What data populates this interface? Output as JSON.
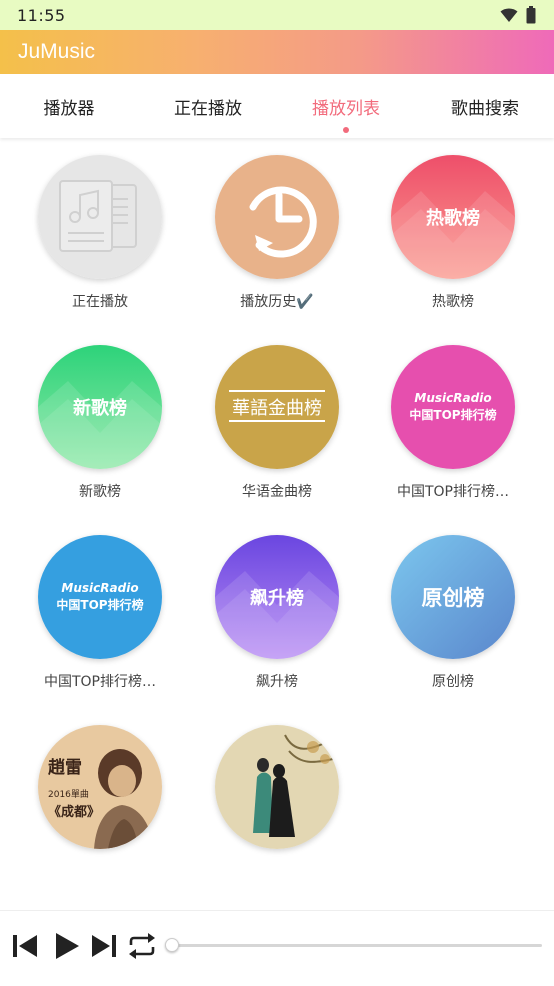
{
  "status_bar": {
    "time": "11:55"
  },
  "app": {
    "title": "JuMusic"
  },
  "tabs": [
    {
      "label": "播放器",
      "active": false
    },
    {
      "label": "正在播放",
      "active": false
    },
    {
      "label": "播放列表",
      "active": true
    },
    {
      "label": "歌曲搜索",
      "active": false
    }
  ],
  "playlists": [
    {
      "caption": "正在播放",
      "icon": "now-playing-document-icon"
    },
    {
      "caption": "播放历史✔️",
      "icon": "history-clock-icon"
    },
    {
      "caption": "热歌榜",
      "badge": "热歌榜"
    },
    {
      "caption": "新歌榜",
      "badge": "新歌榜"
    },
    {
      "caption": "华语金曲榜",
      "badge": "華語金曲榜"
    },
    {
      "caption": "中国TOP排行榜…",
      "badge_top": "MusicRadio",
      "badge_bottom": "中国TOP排行榜"
    },
    {
      "caption": "中国TOP排行榜…",
      "badge_top": "MusicRadio",
      "badge_bottom": "中国TOP排行榜"
    },
    {
      "caption": "飙升榜",
      "badge": "飙升榜"
    },
    {
      "caption": "原创榜",
      "badge": "原创榜"
    },
    {
      "caption": "",
      "art_text_title": "趙雷",
      "art_text_sub": "2016單曲",
      "art_text_song": "《成都》"
    },
    {
      "caption": ""
    }
  ],
  "player": {
    "progress": 0.0,
    "icons": [
      "skip-previous-icon",
      "play-icon",
      "skip-next-icon",
      "repeat-icon"
    ]
  },
  "colors": {
    "accent": "#f26b7c",
    "appbar_start": "#f4c04a",
    "appbar_end": "#ef6ab9"
  }
}
